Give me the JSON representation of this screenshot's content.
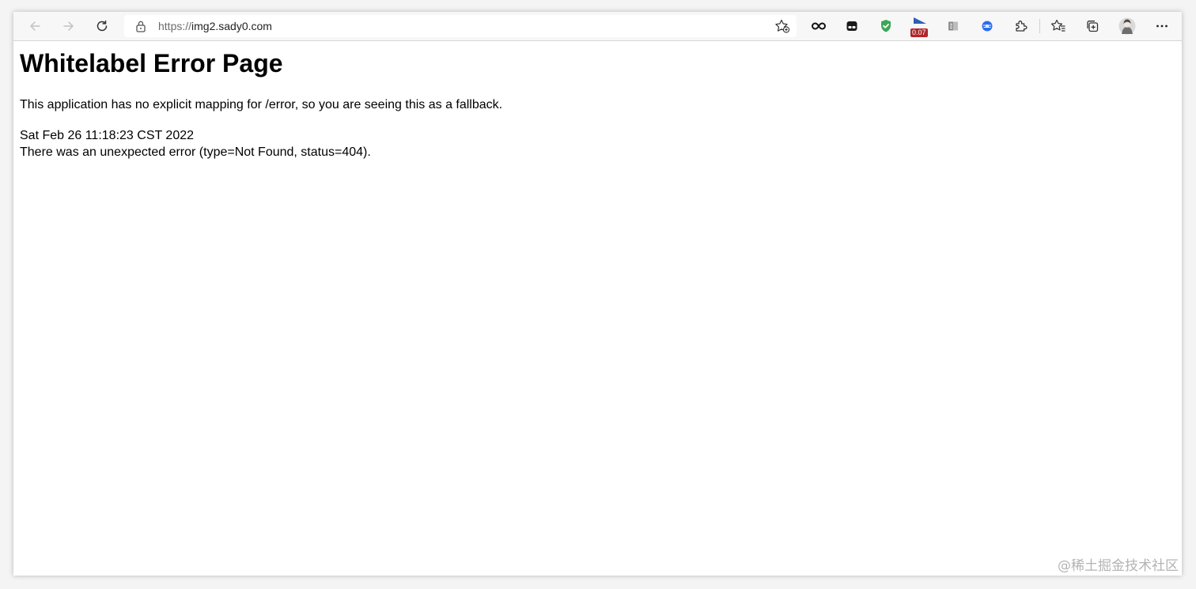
{
  "browser": {
    "address_bar": {
      "url_scheme": "https://",
      "url_host": "img2.sady0.com"
    },
    "toolbar_icons": [
      "back-icon",
      "forward-icon",
      "refresh-icon",
      "lock-icon",
      "add-favorite-icon",
      "infinity-extension-icon",
      "mask-extension-icon",
      "shield-extension-icon",
      "flag-extension-icon",
      "book-extension-icon",
      "globe-extension-icon",
      "extensions-puzzle-icon",
      "favorites-icon",
      "collections-icon",
      "profile-avatar",
      "more-icon"
    ],
    "extension_badge": "0.07",
    "colors": {
      "shield": "#3aa757",
      "badge": "#b0262b",
      "globe": "#2a6ef0"
    }
  },
  "page": {
    "heading": "Whitelabel Error Page",
    "message": "This application has no explicit mapping for /error, so you are seeing this as a fallback.",
    "timestamp": "Sat Feb 26 11:18:23 CST 2022",
    "error_line": "There was an unexpected error (type=Not Found, status=404)."
  },
  "watermark": "@稀土掘金技术社区"
}
